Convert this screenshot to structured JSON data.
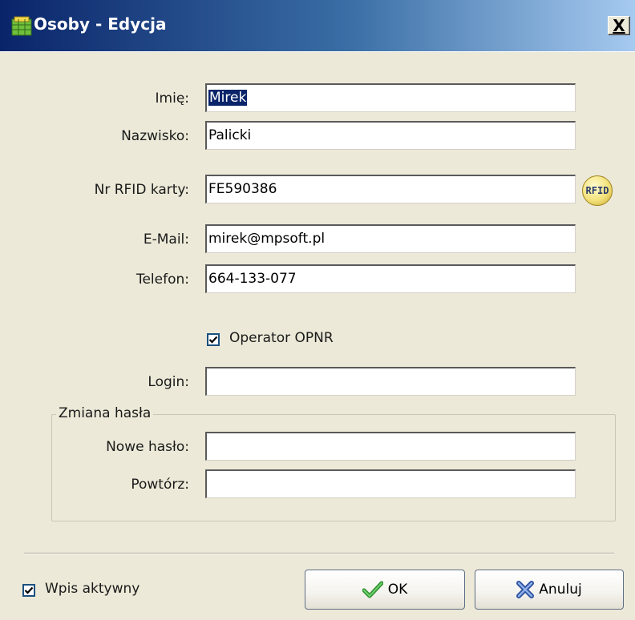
{
  "window": {
    "title": "Osoby - Edycja",
    "close_label": "X"
  },
  "form": {
    "imie": {
      "label": "Imię:",
      "value": "Mirek"
    },
    "nazwisko": {
      "label": "Nazwisko:",
      "value": "Palicki"
    },
    "rfid": {
      "label": "Nr RFID karty:",
      "value": "FE590386",
      "button_label": "RFID"
    },
    "email": {
      "label": "E-Mail:",
      "value": "mirek@mpsoft.pl"
    },
    "telefon": {
      "label": "Telefon:",
      "value": "664-133-077"
    },
    "operator": {
      "label": "Operator OPNR",
      "checked": true
    },
    "login": {
      "label": "Login:",
      "value": ""
    }
  },
  "password_group": {
    "title": "Zmiana hasła",
    "new": {
      "label": "Nowe hasło:",
      "value": ""
    },
    "repeat": {
      "label": "Powtórz:",
      "value": ""
    }
  },
  "footer": {
    "active": {
      "label": "Wpis aktywny",
      "checked": true
    },
    "ok_label": "OK",
    "cancel_label": "Anuluj"
  },
  "colors": {
    "titlebar_start": "#0a246a",
    "titlebar_end": "#a6caf0",
    "dialog_bg": "#ece9d8",
    "ok_icon": "#3aa63a",
    "cancel_icon": "#3a5fb5"
  },
  "icons": {
    "title": "app-grid-icon",
    "rfid": "rfid-icon",
    "ok": "checkmark-icon",
    "cancel": "x-cross-icon"
  }
}
